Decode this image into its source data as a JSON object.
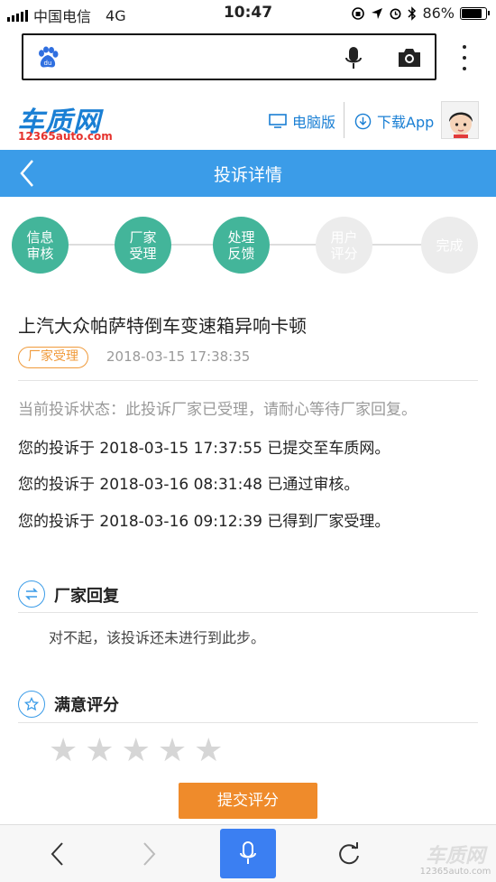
{
  "status_bar": {
    "carrier": "中国电信",
    "network": "4G",
    "time": "10:47",
    "battery": "86%",
    "battery_level": 0.86
  },
  "browser": {
    "search_placeholder": "",
    "icons": [
      "baidu-paw-icon",
      "microphone-icon",
      "camera-icon",
      "more-vertical-icon"
    ]
  },
  "site": {
    "logo": "车质网",
    "logo_url_text": "12365auto.com",
    "desktop_link": "电脑版",
    "download_link": "下载App"
  },
  "page": {
    "title": "投诉详情"
  },
  "steps": [
    {
      "label": "信息审核",
      "state": "done"
    },
    {
      "label": "厂家受理",
      "state": "done"
    },
    {
      "label": "处理反馈",
      "state": "done"
    },
    {
      "label": "用户评分",
      "state": "todo"
    },
    {
      "label": "完成",
      "state": "todo"
    }
  ],
  "complaint": {
    "title": "上汽大众帕萨特倒车变速箱异响卡顿",
    "badge": "厂家受理",
    "time": "2018-03-15 17:38:35",
    "current_status": "当前投诉状态：此投诉厂家已受理，请耐心等待厂家回复。",
    "logs": [
      "您的投诉于 2018-03-15 17:37:55 已提交至车质网。",
      "您的投诉于 2018-03-16 08:31:48 已通过审核。",
      "您的投诉于 2018-03-16 09:12:39 已得到厂家受理。"
    ]
  },
  "reply_section": {
    "title": "厂家回复",
    "text": "对不起，该投诉还未进行到此步。"
  },
  "rating_section": {
    "title": "满意评分",
    "stars_filled": 0,
    "stars_total": 5,
    "submit_label": "提交评分"
  },
  "watermark": {
    "main": "车质网",
    "sub": "12365auto.com"
  },
  "colors": {
    "accent_blue": "#3b9ce8",
    "step_done": "#43b59a",
    "badge_orange": "#f09a3a",
    "submit_orange": "#ef8b2b",
    "voice_blue": "#3b7ff2"
  }
}
